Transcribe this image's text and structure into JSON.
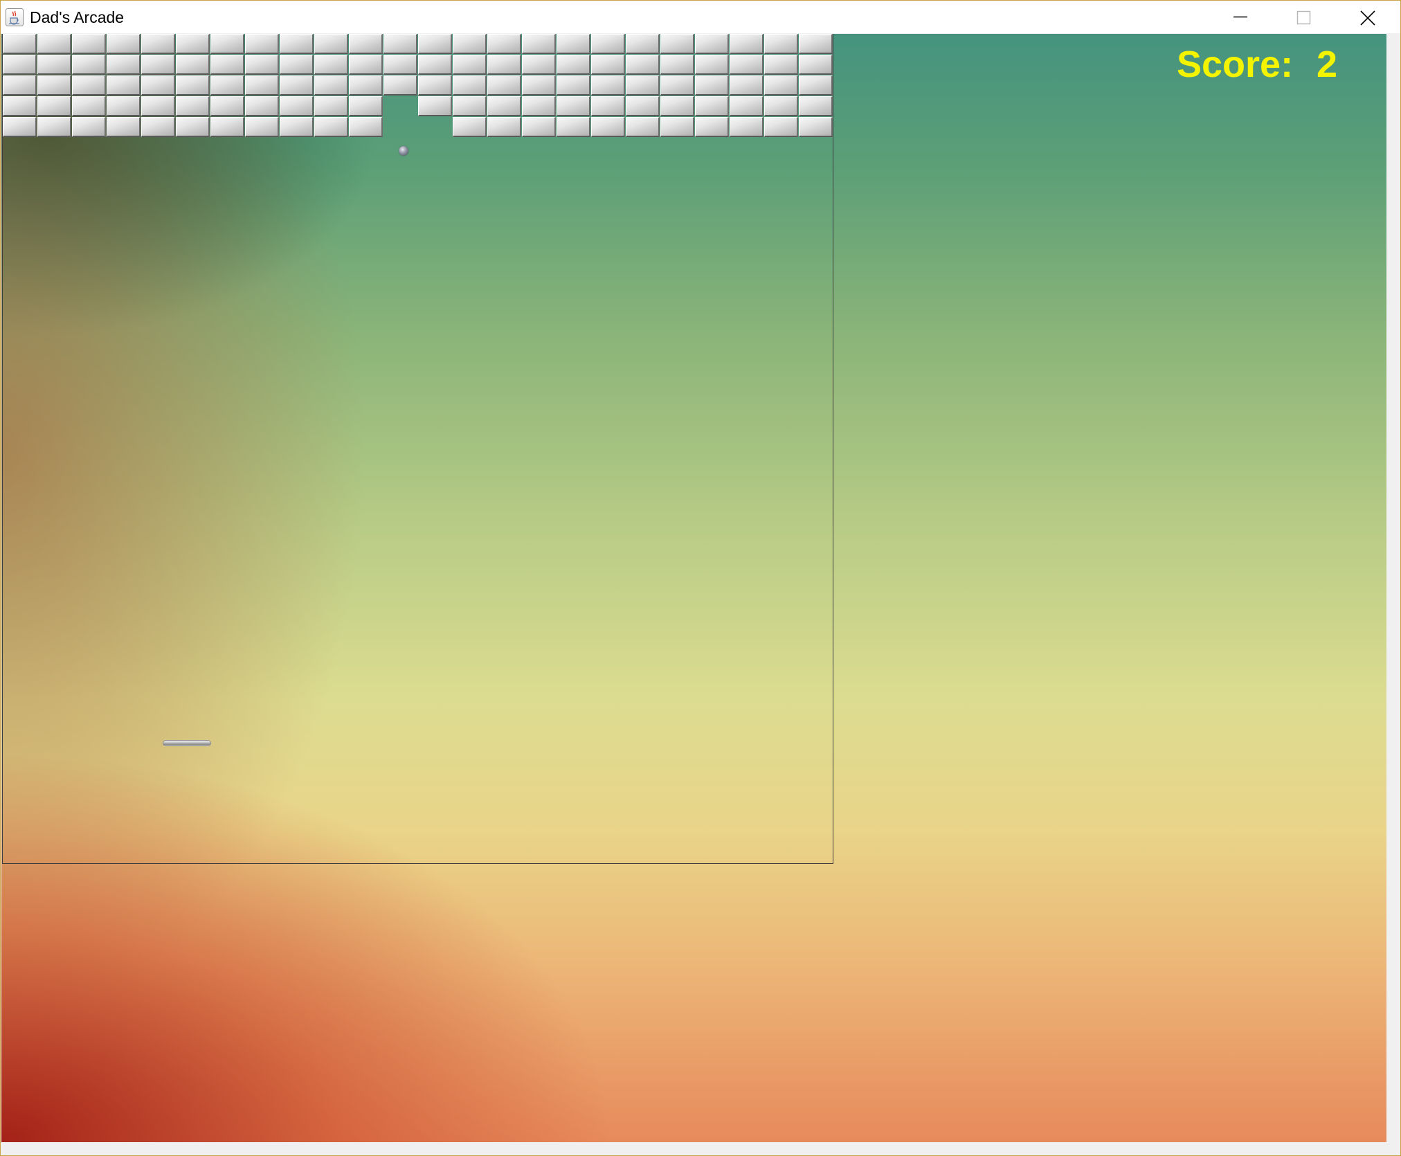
{
  "window": {
    "title": "Dad's Arcade",
    "icon": "java-cup-icon",
    "controls": [
      "minimize",
      "maximize",
      "close"
    ]
  },
  "hud": {
    "score_label": "Score:",
    "score_value": "2"
  },
  "game": {
    "brick_columns": 24,
    "brick_rows": 5,
    "missing_bricks": [
      [
        4,
        11
      ],
      [
        4,
        12
      ],
      [
        3,
        11
      ]
    ],
    "colors": {
      "score_text": "#f4f400",
      "brick": "#d9d9d9",
      "playfield_border": "#3c3c3c"
    }
  }
}
